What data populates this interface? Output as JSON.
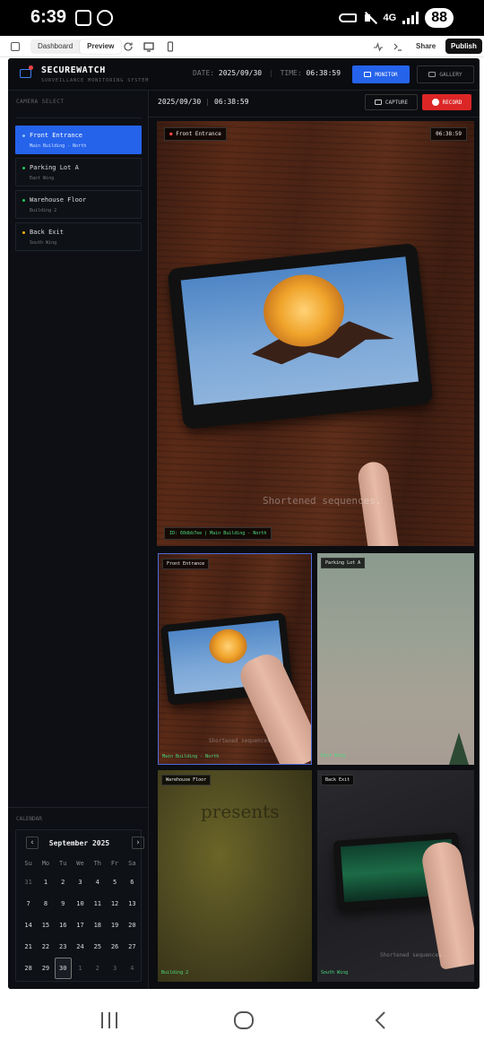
{
  "status_bar": {
    "time": "6:39",
    "network": "4G",
    "battery": "88"
  },
  "toolbar": {
    "dashboard": "Dashboard",
    "preview": "Preview",
    "share": "Share",
    "publish": "Publish"
  },
  "header": {
    "brand": "SECUREWATCH",
    "subtitle": "SURVEILLANCE MONITORING SYSTEM",
    "date_label": "DATE:",
    "date_value": "2025/09/30",
    "time_label": "TIME:",
    "time_value": "06:38:59",
    "monitor": "MONITOR",
    "gallery": "GALLERY"
  },
  "sidebar": {
    "camera_select": "CAMERA SELECT",
    "cameras": [
      {
        "name": "Front Entrance",
        "location": "Main Building - North",
        "dot_color": "#93c5fd"
      },
      {
        "name": "Parking Lot A",
        "location": "East Wing",
        "dot_color": "#22c55e"
      },
      {
        "name": "Warehouse Floor",
        "location": "Building 2",
        "dot_color": "#22c55e"
      },
      {
        "name": "Back Exit",
        "location": "South Wing",
        "dot_color": "#eab308"
      }
    ],
    "calendar_label": "CALENDAR",
    "calendar": {
      "month": "September 2025",
      "weekdays": [
        "Su",
        "Mo",
        "Tu",
        "We",
        "Th",
        "Fr",
        "Sa"
      ],
      "days": [
        "31",
        "1",
        "2",
        "3",
        "4",
        "5",
        "6",
        "7",
        "8",
        "9",
        "10",
        "11",
        "12",
        "13",
        "14",
        "15",
        "16",
        "17",
        "18",
        "19",
        "20",
        "21",
        "22",
        "23",
        "24",
        "25",
        "26",
        "27",
        "28",
        "29",
        "30",
        "1",
        "2",
        "3",
        "4"
      ],
      "selected": "30"
    }
  },
  "main": {
    "date": "2025/09/30",
    "time": "06:38:59",
    "capture": "CAPTURE",
    "record": "RECORD",
    "primary_feed": {
      "title": "Front Entrance",
      "timestamp": "06:38:59",
      "id_label": "ID: 60dbb7ee | Main Building - North",
      "watermark": "Shortened sequences."
    },
    "thumbnails": [
      {
        "title": "Front Entrance",
        "location": "Main Building - North",
        "watermark": "Shortened sequences."
      },
      {
        "title": "Parking Lot A",
        "location": "East Wing"
      },
      {
        "title": "Warehouse Floor",
        "location": "Building 2",
        "overlay_text": "presents"
      },
      {
        "title": "Back Exit",
        "location": "South Wing",
        "watermark": "Shortened sequences."
      }
    ]
  },
  "colors": {
    "accent": "#2563eb",
    "record": "#dc2626",
    "live_green": "#4ade80"
  }
}
